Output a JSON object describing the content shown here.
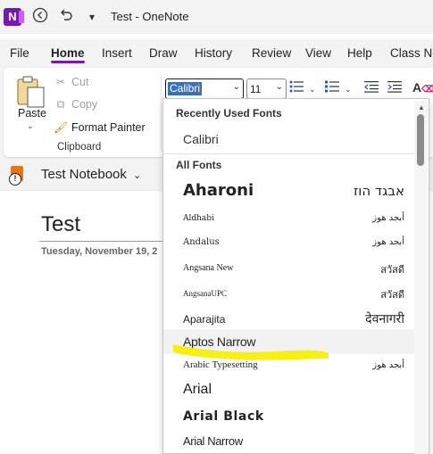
{
  "app": {
    "title": "Test  -  OneNote",
    "icon": "onenote-logo-icon",
    "accent": "#7719aa"
  },
  "quick_access": {
    "back_icon": "back-arrow-icon",
    "undo_icon": "undo-icon",
    "customize_icon": "customize-quick-access-icon"
  },
  "menu": {
    "tabs": [
      "File",
      "Home",
      "Insert",
      "Draw",
      "History",
      "Review",
      "View",
      "Help",
      "Class No"
    ],
    "active": "Home"
  },
  "ribbon": {
    "clipboard": {
      "paste_label": "Paste",
      "cut_label": "Cut",
      "copy_label": "Copy",
      "format_painter_label": "Format Painter",
      "group_label": "Clipboard"
    },
    "font": {
      "font_name": "Calibri",
      "font_size": "11"
    }
  },
  "notebook": {
    "name": "Test Notebook",
    "icon_color": "#e8731a"
  },
  "page": {
    "title": "Test",
    "date": "Tuesday, November 19, 2"
  },
  "font_menu": {
    "recent_header": "Recently Used Fonts",
    "all_header": "All Fonts",
    "recent": [
      {
        "name": "Calibri"
      }
    ],
    "fonts": [
      {
        "name": "Aharoni",
        "sample": "אבגד הוז"
      },
      {
        "name": "Aldhabi",
        "sample": "أبجد هوز"
      },
      {
        "name": "Andalus",
        "sample": "أبجد هوز"
      },
      {
        "name": "Angsana New",
        "sample": "สวัสดี"
      },
      {
        "name": "AngsanaUPC",
        "sample": "สวัสดี"
      },
      {
        "name": "Aparajita",
        "sample": "देवनागरी"
      },
      {
        "name": "Aptos Narrow",
        "sample": ""
      },
      {
        "name": "Arabic Typesetting",
        "sample": "أبجد هوز"
      },
      {
        "name": "Arial",
        "sample": ""
      },
      {
        "name": "Arial Black",
        "sample": ""
      },
      {
        "name": "Arial Narrow",
        "sample": ""
      }
    ],
    "highlighted": "Aptos Narrow",
    "highlight_color": "#f5ef00"
  }
}
